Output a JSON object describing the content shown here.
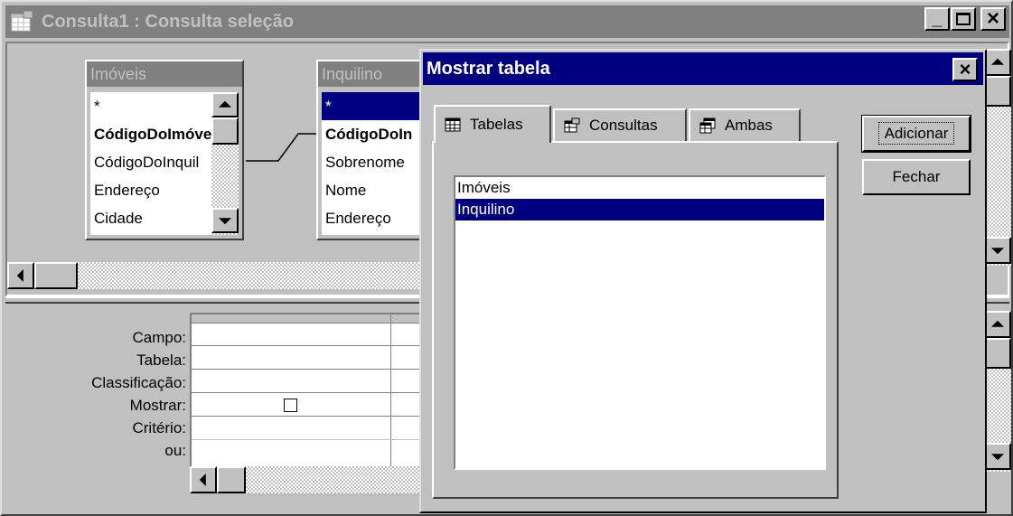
{
  "window": {
    "title": "Consulta1 : Consulta seleção",
    "minimize_label": "_",
    "maximize_label": "□",
    "close_label": "×"
  },
  "tables": [
    {
      "title": "Imóveis",
      "fields": [
        "*",
        "CódigoDoImóve",
        "CódigoDoInquil",
        "Endereço",
        "Cidade"
      ]
    },
    {
      "title": "Inquilino",
      "fields": [
        "*",
        "CódigoDoIn",
        "Sobrenome",
        "Nome",
        "Endereço"
      ]
    }
  ],
  "grid": {
    "row_labels": [
      "Campo:",
      "Tabela:",
      "Classificação:",
      "Mostrar:",
      "Critério:",
      "ou:"
    ]
  },
  "dialog": {
    "title": "Mostrar tabela",
    "close_label": "×",
    "tabs": [
      {
        "label": "Tabelas",
        "icon": "table-icon",
        "active": true
      },
      {
        "label": "Consultas",
        "icon": "query-icon",
        "active": false
      },
      {
        "label": "Ambas",
        "icon": "both-icon",
        "active": false
      }
    ],
    "list_items": [
      "Imóveis",
      "Inquilino"
    ],
    "selected_item": "Inquilino",
    "buttons": {
      "add_label": "Adicionar",
      "close_label": "Fechar"
    }
  },
  "colors": {
    "selection": "#000080",
    "face": "#c0c0c0",
    "inactive_title": "#808080"
  }
}
